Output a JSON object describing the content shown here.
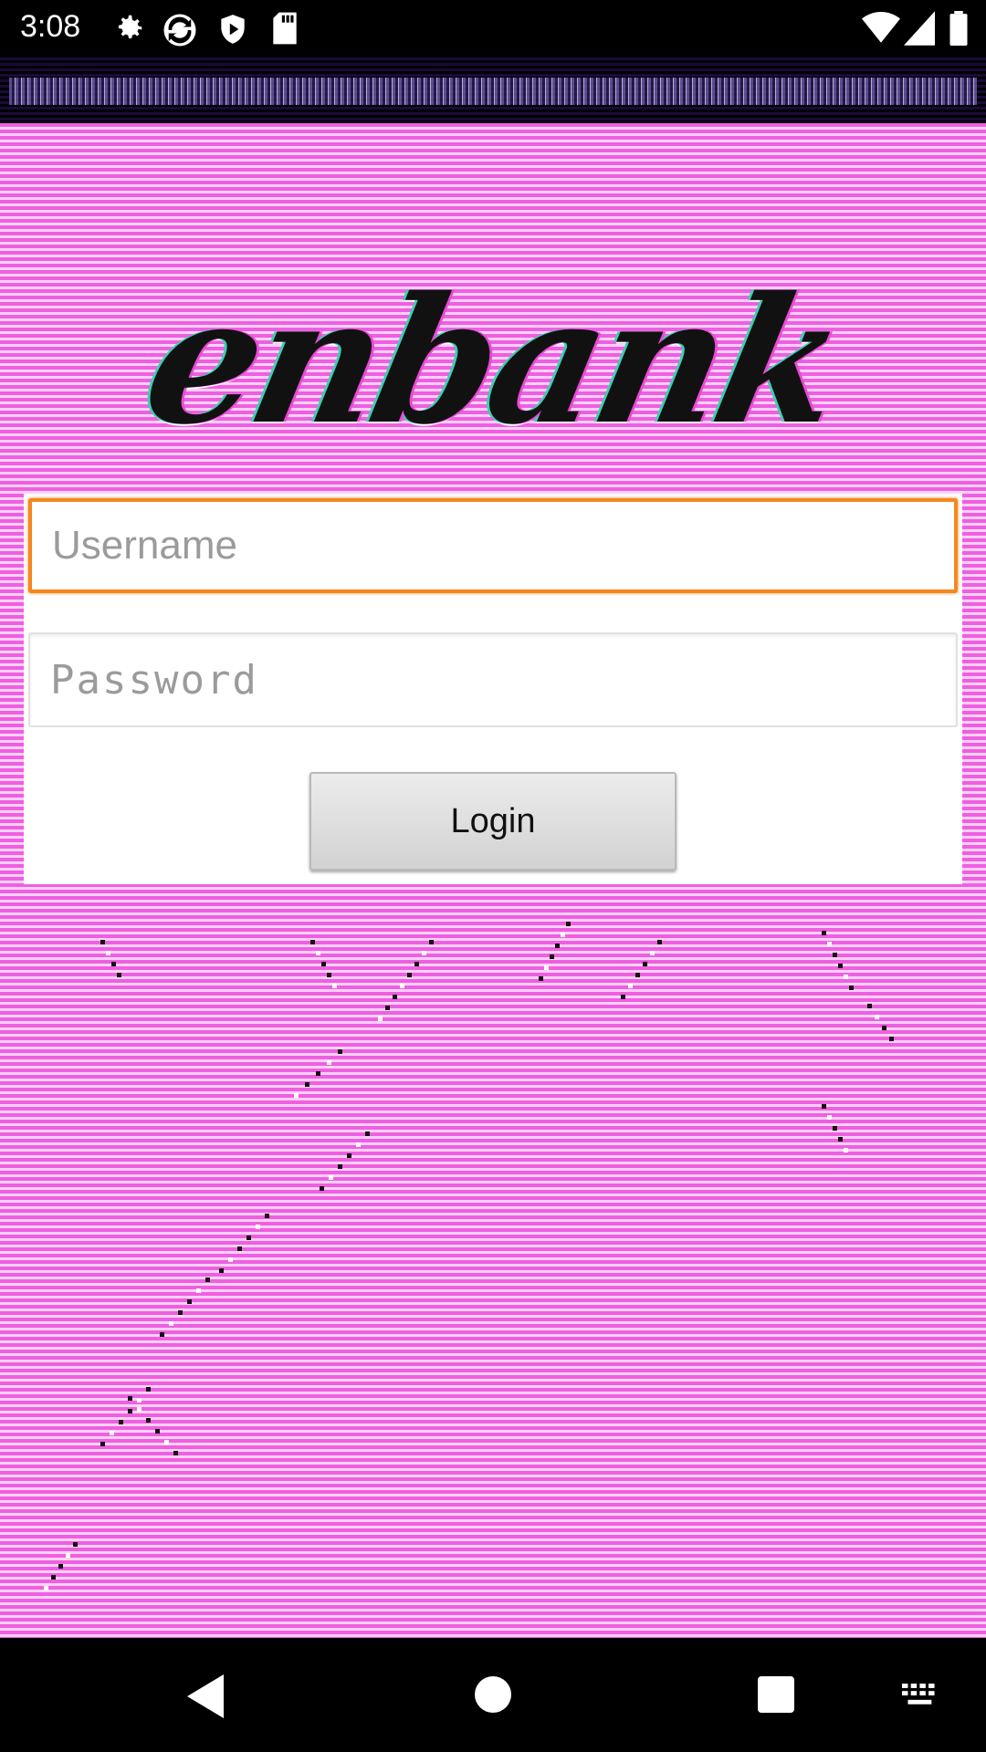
{
  "status_bar": {
    "time": "3:08",
    "left_icons": [
      "settings-icon",
      "sync-icon",
      "shield-icon",
      "sd-card-icon"
    ],
    "right_icons": [
      "wifi-icon",
      "signal-icon",
      "battery-icon"
    ]
  },
  "logo": {
    "text": "enbank"
  },
  "login_form": {
    "username_placeholder": "Username",
    "username_value": "",
    "password_placeholder": "Password",
    "password_value": "",
    "login_label": "Login"
  },
  "navigation_bar": {
    "buttons": [
      "back-icon",
      "home-icon",
      "recents-icon",
      "keyboard-icon"
    ]
  },
  "colors": {
    "background_pink": "#ef5fe2",
    "focus_orange": "#f5871f",
    "card_white": "#ffffff"
  }
}
